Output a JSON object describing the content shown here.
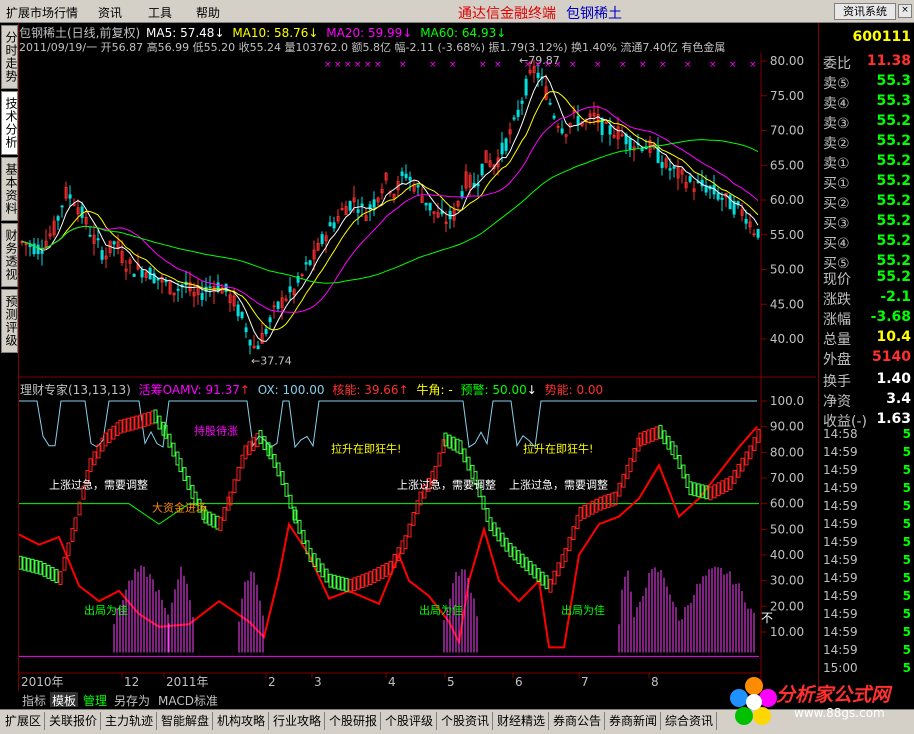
{
  "menu": {
    "items": [
      "扩展市场行情",
      "资讯",
      "工具",
      "帮助"
    ],
    "brand": "通达信金融终端",
    "stock_name": "包钢稀土",
    "sys_button": "资讯系统",
    "close": "×"
  },
  "left_tabs": [
    "分时走势",
    "技术分析",
    "基本资料",
    "财务透视",
    "预测评级"
  ],
  "kline": {
    "title": "包钢稀土(日线,前复权)",
    "ma5": "MA5: 57.48",
    "ma10": "MA10: 58.76",
    "ma20": "MA20: 59.99",
    "ma60": "MA60: 64.93",
    "quote_line": "2011/09/19/一 开56.87 高56.99 低55.20 收55.24 量103762.0 额5.8亿 幅-2.11 (-3.68%) 振1.79(3.12%) 换1.40% 流通7.40亿 有色金属",
    "y_ticks": [
      "80.00",
      "75.00",
      "70.00",
      "65.00",
      "60.00",
      "55.00",
      "50.00",
      "45.00",
      "40.00"
    ],
    "high_label": "79.87",
    "low_label": "37.74",
    "high_marker": "←",
    "low_marker": "←"
  },
  "indicator": {
    "title": "理财专家(13,13,13)",
    "oamv": "活筹OAMV: 91.37",
    "ox": "OX: 100.00",
    "hn": "核能: 39.66",
    "nj": "牛角: -",
    "yj": "预警: 50.00",
    "sn": "势能: 0.00",
    "y_ticks": [
      "100.0",
      "90.00",
      "80.00",
      "70.00",
      "60.00",
      "50.00",
      "40.00",
      "30.00",
      "20.00",
      "10.00"
    ],
    "annotations": [
      "持股待涨",
      "拉升在即狂牛!",
      "拉升在即狂牛!",
      "上涨过急，需要调整",
      "上涨过急，需要调整",
      "上涨过急，需要调整",
      "大资金进场",
      "出局为佳",
      "出局为佳",
      "出局为佳"
    ],
    "side_mark": "不"
  },
  "time_axis": [
    "2010年",
    "12",
    "2011年",
    "2",
    "3",
    "4",
    "5",
    "6",
    "7",
    "8"
  ],
  "right_panel": {
    "code": "600111",
    "weibi_label": "委比",
    "weibi_value": "11.38",
    "sells": [
      {
        "label": "卖⑤",
        "value": "55.3"
      },
      {
        "label": "卖④",
        "value": "55.3"
      },
      {
        "label": "卖③",
        "value": "55.2"
      },
      {
        "label": "卖②",
        "value": "55.2"
      },
      {
        "label": "卖①",
        "value": "55.2"
      }
    ],
    "buys": [
      {
        "label": "买①",
        "value": "55.2"
      },
      {
        "label": "买②",
        "value": "55.2"
      },
      {
        "label": "买③",
        "value": "55.2"
      },
      {
        "label": "买④",
        "value": "55.2"
      },
      {
        "label": "买⑤",
        "value": "55.2"
      }
    ],
    "stats": [
      {
        "label": "现价",
        "value": "55.2"
      },
      {
        "label": "涨跌",
        "value": "-2.1"
      },
      {
        "label": "涨幅",
        "value": "-3.68"
      },
      {
        "label": "总量",
        "value": "10.4"
      },
      {
        "label": "外盘",
        "value": "5140"
      },
      {
        "label": "换手",
        "value": "1.40"
      },
      {
        "label": "净资",
        "value": "3.4"
      },
      {
        "label": "收益(-)",
        "value": "1.63"
      }
    ],
    "ticks": [
      {
        "t": "14:58",
        "v": "5"
      },
      {
        "t": "14:59",
        "v": "5"
      },
      {
        "t": "14:59",
        "v": "5"
      },
      {
        "t": "14:59",
        "v": "5"
      },
      {
        "t": "14:59",
        "v": "5"
      },
      {
        "t": "14:59",
        "v": "5"
      },
      {
        "t": "14:59",
        "v": "5"
      },
      {
        "t": "14:59",
        "v": "5"
      },
      {
        "t": "14:59",
        "v": "5"
      },
      {
        "t": "14:59",
        "v": "5"
      },
      {
        "t": "14:59",
        "v": "5"
      },
      {
        "t": "14:59",
        "v": "5"
      },
      {
        "t": "14:59",
        "v": "5"
      },
      {
        "t": "15:00",
        "v": "5"
      }
    ]
  },
  "bottom_tabs": [
    "指标",
    "模板",
    "管理",
    "另存为",
    "MACD标准"
  ],
  "status_bar": [
    "扩展区",
    "关联报价",
    "主力轨迹",
    "智能解盘",
    "机构攻略",
    "行业攻略",
    "个股研报",
    "个股评级",
    "个股资讯",
    "财经精选",
    "券商公告",
    "券商新闻",
    "综合资讯"
  ],
  "logo": {
    "text": "分析家公式网",
    "url": "www.88gs.com"
  },
  "colors": {
    "up": "#ff3030",
    "down": "#00e0e0",
    "ma5": "#ffffff",
    "ma10": "#ffff00",
    "ma20": "#ff00ff",
    "ma60": "#00ff00"
  }
}
